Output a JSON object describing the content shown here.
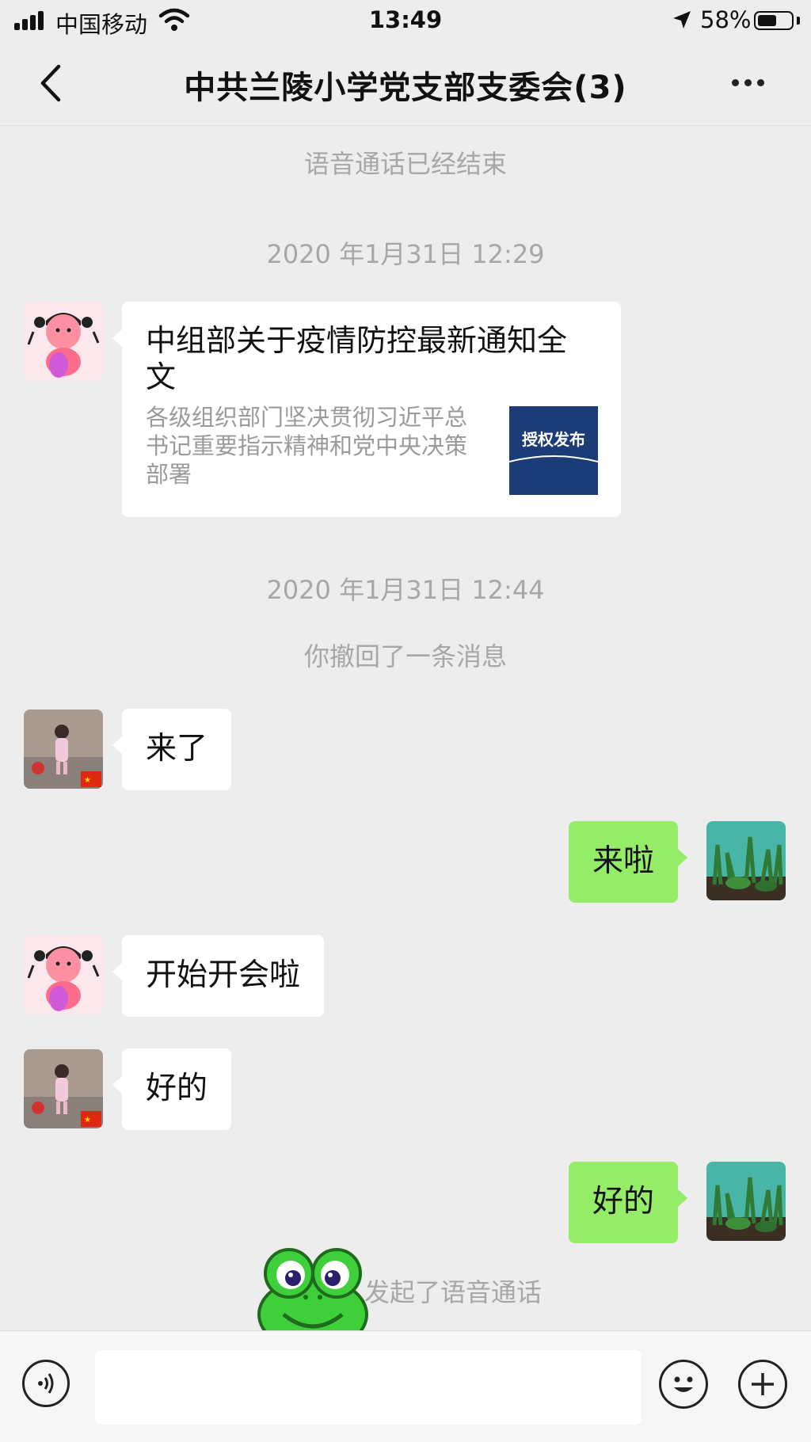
{
  "status_bar": {
    "carrier": "中国移动",
    "time": "13:49",
    "battery": "58%",
    "battery_level": 0.58
  },
  "nav": {
    "title": "中共兰陵小学党支部支委会(3)"
  },
  "chat": {
    "system_call_ended": "语音通话已经结束",
    "timestamp_1": "2020 年1月31日 12:29",
    "card": {
      "title": "中组部关于疫情防控最新通知全文",
      "description": "各级组织部门坚决贯彻习近平总书记重要指示精神和党中央决策部署",
      "thumb_text": "授权发布"
    },
    "timestamp_2": "2020 年1月31日 12:44",
    "system_recall": "你撤回了一条消息",
    "messages": [
      {
        "side": "left",
        "text": "来了"
      },
      {
        "side": "right",
        "text": "来啦"
      },
      {
        "side": "left",
        "text": "开始开会啦"
      },
      {
        "side": "left",
        "text": "好的"
      },
      {
        "side": "right",
        "text": "好的"
      }
    ],
    "system_call_started_visible": "发起了语音通话"
  },
  "icons": {
    "back": "chevron-left-icon",
    "more": "more-dots-icon",
    "voice": "voice-icon",
    "emoji": "emoji-icon",
    "plus": "plus-icon"
  },
  "colors": {
    "background": "#ededed",
    "bubble_self": "#95ec69",
    "bubble_other": "#ffffff",
    "system_text": "#a7a7a7"
  }
}
